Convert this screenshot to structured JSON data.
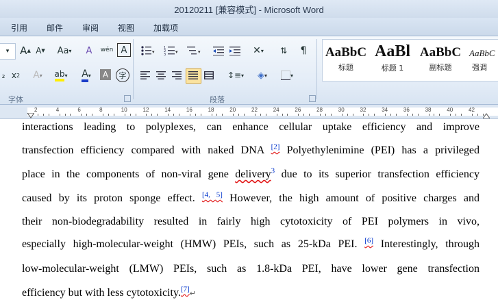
{
  "window": {
    "title": "20120211 [兼容模式] - Microsoft Word"
  },
  "tabs": [
    "引用",
    "邮件",
    "审阅",
    "视图",
    "加载项"
  ],
  "ribbon": {
    "font_group_label": "字体",
    "paragraph_group_label": "段落",
    "styles": [
      {
        "sample": "AaBbC",
        "name": "标题"
      },
      {
        "sample": "AaBl",
        "name": "标题 1"
      },
      {
        "sample": "AaBbC",
        "name": "副标题"
      },
      {
        "sample": "AaBbC",
        "name": "强调"
      }
    ],
    "font_buttons": {
      "grow": "A",
      "shrink": "A",
      "change_case": "Aa",
      "clear_format": "A",
      "phonetic": "wén",
      "char_border": "A",
      "sub": "x",
      "sup": "x",
      "text_effect": "A",
      "highlight": "ab",
      "font_color": "A",
      "char_shade": "A",
      "enclose": "字"
    }
  },
  "ruler": {
    "labels": [
      "2",
      "4",
      "6",
      "8",
      "10",
      "12",
      "14",
      "16",
      "18",
      "20",
      "22",
      "24",
      "26",
      "28",
      "30",
      "32",
      "34",
      "36",
      "38",
      "40",
      "42"
    ]
  },
  "document": {
    "lines": [
      {
        "text": "interactions leading to polyplexes, can enhance cellular uptake efficiency and improve"
      },
      {
        "pre": "transfection efficiency compared with naked DNA ",
        "ref": "[2]",
        "post": " Polyethylenimine (PEI) has a privileged"
      },
      {
        "pre": "place in the components of non-viral gene ",
        "wavy": "delivery",
        "ref": "3",
        "post": "  due to its superior transfection efficiency"
      },
      {
        "pre": "caused by its proton sponge effect. ",
        "ref": "[4, 5]",
        "post": " However, the high amount of positive charges and"
      },
      {
        "text": "their non-biodegradability resulted in fairly high cytotoxicity of PEI polymers in vivo,"
      },
      {
        "pre": "especially high-molecular-weight (HMW) PEIs, such as 25-kDa PEI. ",
        "ref": "[6]",
        "post": " Interestingly, through"
      },
      {
        "text": "low-molecular-weight (LMW) PEIs, such as 1.8-kDa PEI, have lower gene transfection"
      },
      {
        "pre": "efficiency but with less cytotoxicity.",
        "ref": "[7]",
        "post": "↵"
      }
    ]
  }
}
